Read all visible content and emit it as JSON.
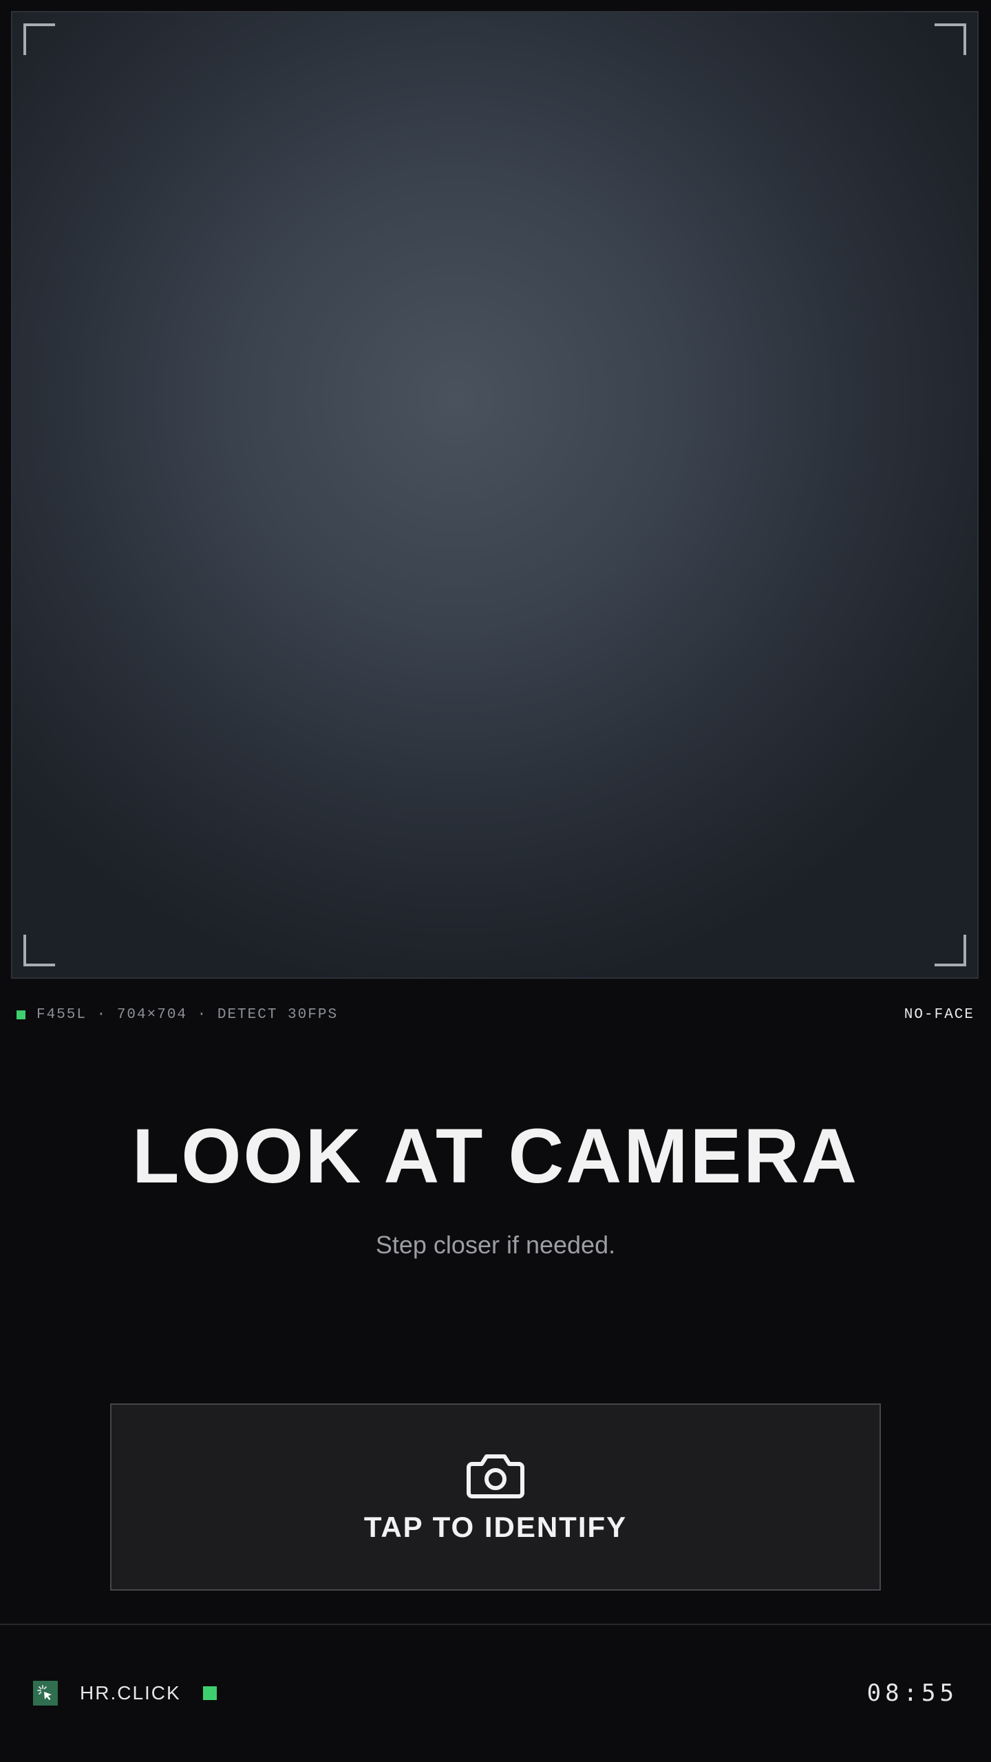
{
  "viewport": {
    "status_text": "F455L · 704×704 · DETECT 30FPS",
    "face_state": "NO-FACE"
  },
  "prompt": {
    "headline": "LOOK AT CAMERA",
    "subline": "Step closer if needed."
  },
  "action": {
    "label": "TAP TO IDENTIFY",
    "icon": "camera-icon"
  },
  "footer": {
    "brand": "HR.CLICK",
    "brand_icon": "cursor-click-icon",
    "time": "08:55"
  },
  "colors": {
    "background": "#0b0b0d",
    "accent_green": "#3ecf6e",
    "logo_green": "#2f6e4f",
    "text_primary": "#f2f2f3",
    "text_muted": "#9c9ea3",
    "button_bg": "#1c1c1f"
  }
}
